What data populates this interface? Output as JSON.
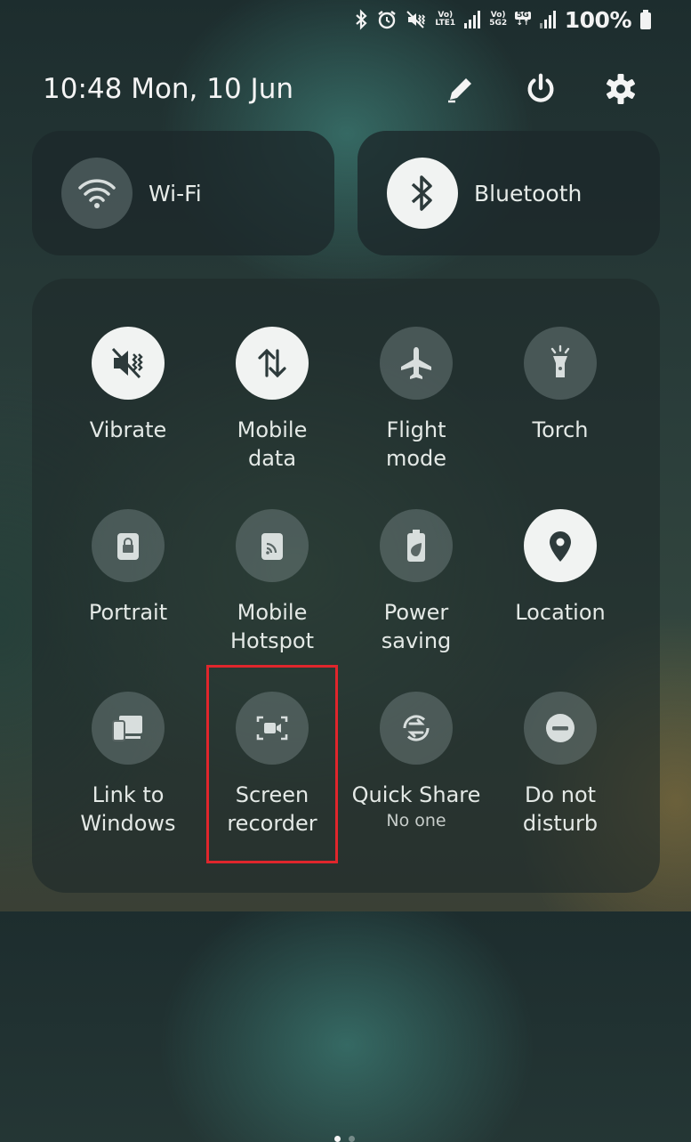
{
  "status_bar": {
    "lte1": "Vo) LTE1",
    "lte2": "Vo) 5G2",
    "network_5g": "5G",
    "battery": "100%"
  },
  "header": {
    "datetime": "10:48  Mon, 10 Jun"
  },
  "big_tiles": [
    {
      "label": "Wi-Fi",
      "state": "off",
      "icon": "wifi-icon"
    },
    {
      "label": "Bluetooth",
      "state": "on",
      "icon": "bluetooth-icon"
    }
  ],
  "tiles": [
    {
      "label": "Vibrate",
      "state": "on",
      "icon": "vibrate-icon"
    },
    {
      "label": "Mobile\ndata",
      "state": "on",
      "icon": "mobile-data-icon"
    },
    {
      "label": "Flight\nmode",
      "state": "off",
      "icon": "airplane-icon"
    },
    {
      "label": "Torch",
      "state": "off",
      "icon": "torch-icon"
    },
    {
      "label": "Portrait",
      "state": "off",
      "icon": "portrait-lock-icon"
    },
    {
      "label": "Mobile\nHotspot",
      "state": "off",
      "icon": "hotspot-icon"
    },
    {
      "label": "Power\nsaving",
      "state": "off",
      "icon": "power-saving-icon"
    },
    {
      "label": "Location",
      "state": "on",
      "icon": "location-icon"
    },
    {
      "label": "Link to\nWindows",
      "state": "off",
      "icon": "link-to-windows-icon"
    },
    {
      "label": "Screen\nrecorder",
      "state": "off",
      "icon": "screen-recorder-icon"
    },
    {
      "label": "Quick Share",
      "sublabel": "No one",
      "state": "off",
      "icon": "quick-share-icon"
    },
    {
      "label": "Do not\ndisturb",
      "state": "off",
      "icon": "do-not-disturb-icon"
    }
  ],
  "colors": {
    "tile_on": "#f1f3f2",
    "tile_off": "#6f7c7b",
    "highlight": "#e0262c"
  },
  "pager": {
    "current": 1,
    "total": 2
  }
}
